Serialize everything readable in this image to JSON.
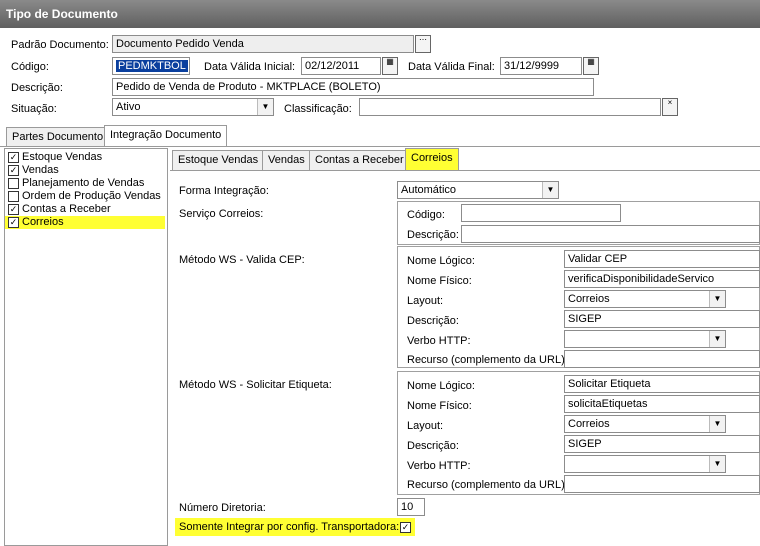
{
  "window": {
    "title": "Tipo de Documento"
  },
  "header": {
    "padrao_label": "Padrão Documento:",
    "padrao_value": "Documento Pedido Venda",
    "codigo_label": "Código:",
    "codigo_value": "PEDMKTBOL",
    "data_inicial_label": "Data Válida Inicial:",
    "data_inicial_value": "02/12/2011",
    "data_final_label": "Data Válida Final:",
    "data_final_value": "31/12/9999",
    "descricao_label": "Descrição:",
    "descricao_value": "Pedido de Venda de Produto - MKTPLACE (BOLETO)",
    "situacao_label": "Situação:",
    "situacao_value": "Ativo",
    "classificacao_label": "Classificação:",
    "classificacao_value": ""
  },
  "main_tabs": [
    "Partes Documento",
    "Integração Documento"
  ],
  "tree": {
    "items": [
      {
        "label": "Estoque Vendas",
        "checked": true
      },
      {
        "label": "Vendas",
        "checked": true
      },
      {
        "label": "Planejamento de Vendas",
        "checked": false
      },
      {
        "label": "Ordem de Produção Vendas",
        "checked": false
      },
      {
        "label": "Contas a Receber",
        "checked": true
      },
      {
        "label": "Correios",
        "checked": true
      }
    ]
  },
  "sub_tabs": [
    "Estoque Vendas",
    "Vendas",
    "Contas a Receber",
    "Correios"
  ],
  "correios": {
    "forma_label": "Forma Integração:",
    "forma_value": "Automático",
    "servico_label": "Serviço Correios:",
    "servico_codigo_label": "Código:",
    "servico_codigo_value": "",
    "servico_descricao_label": "Descrição:",
    "servico_descricao_value": "",
    "metodo_cep_label": "Método WS - Valida CEP:",
    "metodo_etiqueta_label": "Método WS - Solicitar Etiqueta:",
    "ws_labels": {
      "nome_logico": "Nome Lógico:",
      "nome_fisico": "Nome Físico:",
      "layout": "Layout:",
      "descricao": "Descrição:",
      "verbo": "Verbo HTTP:",
      "recurso": "Recurso (complemento da URL):"
    },
    "cep": {
      "nome_logico": "Validar CEP",
      "nome_fisico": "verificaDisponibilidadeServico",
      "layout": "Correios",
      "descricao": "SIGEP",
      "verbo": "",
      "recurso": ""
    },
    "etiqueta": {
      "nome_logico": "Solicitar Etiqueta",
      "nome_fisico": "solicitaEtiquetas",
      "layout": "Correios",
      "descricao": "SIGEP",
      "verbo": "",
      "recurso": ""
    },
    "numero_diretoria_label": "Número Diretoria:",
    "numero_diretoria_value": "10",
    "somente_label": "Somente Integrar por config. Transportadora:",
    "somente_checked": true
  },
  "colors": {
    "highlight": "#ffff33",
    "title_bar": "#6e6e6e",
    "selection": "#0a3f9e"
  },
  "icons": [
    "ellipsis-icon",
    "calendar-icon",
    "close-icon",
    "dropdown-arrow-icon",
    "checkmark-icon"
  ]
}
